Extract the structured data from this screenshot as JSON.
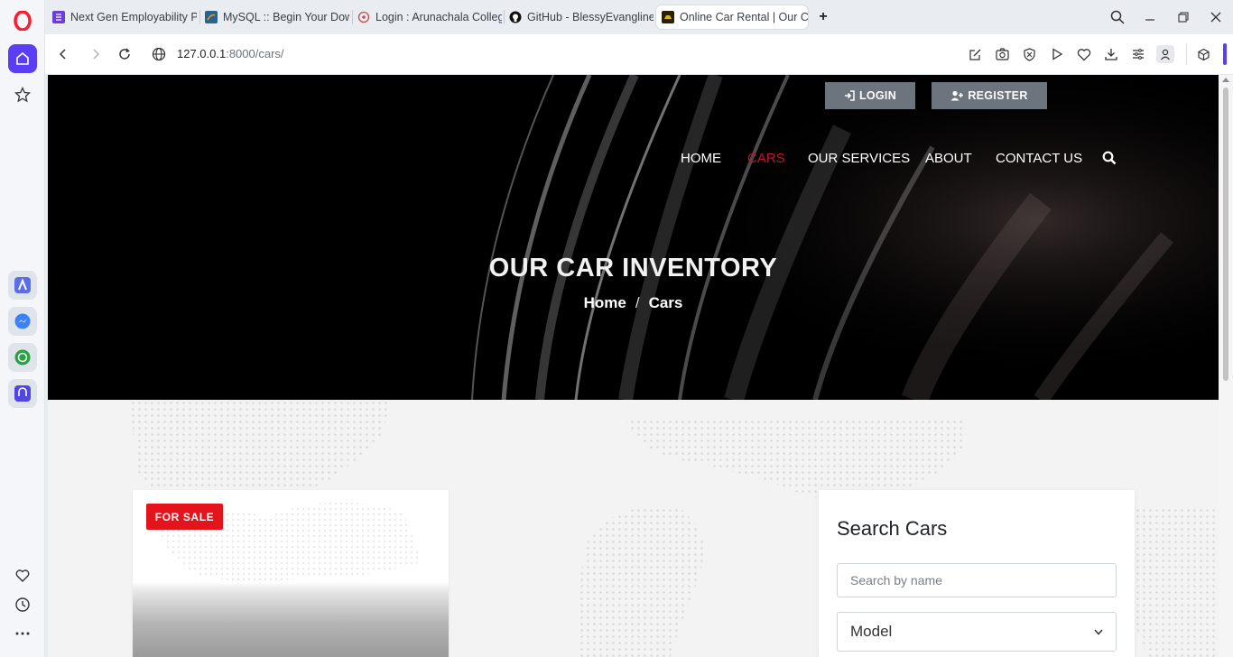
{
  "browser": {
    "tabs": [
      {
        "title": "Next Gen Employability Pr",
        "favicon": "list-icon",
        "color": "#6a3fd9"
      },
      {
        "title": "MySQL :: Begin Your Down",
        "favicon": "mysql-dolphin-icon",
        "color": "#29658a"
      },
      {
        "title": "Login : Arunachala College",
        "favicon": "globe-icon",
        "color": "#c0504d"
      },
      {
        "title": "GitHub - BlessyEvangline/",
        "favicon": "github-icon",
        "color": "#111111"
      },
      {
        "title": "Online Car Rental | Our Ca",
        "favicon": "car-site-icon",
        "color": "#8a6a00"
      }
    ],
    "active_tab_index": 4,
    "url_host": "127.0.0.1",
    "url_rest": ":8000/cars/"
  },
  "sidebar": {
    "items": [
      "opera-logo",
      "home-icon",
      "star-icon",
      "aria-icon",
      "messenger-icon",
      "whatsapp-icon",
      "music-icon",
      "heart-icon",
      "history-icon",
      "more-icon"
    ],
    "accent": "#5b3df5"
  },
  "site": {
    "auth": {
      "login_label": "LOGIN",
      "register_label": "REGISTER"
    },
    "nav": {
      "items": [
        {
          "label": "HOME"
        },
        {
          "label": "CARS"
        },
        {
          "label": "OUR SERVICES"
        },
        {
          "label": "ABOUT"
        },
        {
          "label": "CONTACT US"
        }
      ],
      "active_index": 1,
      "active_color": "#c8102e"
    },
    "hero": {
      "title": "OUR CAR INVENTORY",
      "breadcrumb_home": "Home",
      "breadcrumb_sep": "/",
      "breadcrumb_current": "Cars"
    },
    "listing": {
      "badge": "FOR SALE",
      "badge_color": "#e3141b"
    },
    "search": {
      "title": "Search Cars",
      "name_placeholder": "Search by name",
      "model_selected": "Model"
    }
  }
}
